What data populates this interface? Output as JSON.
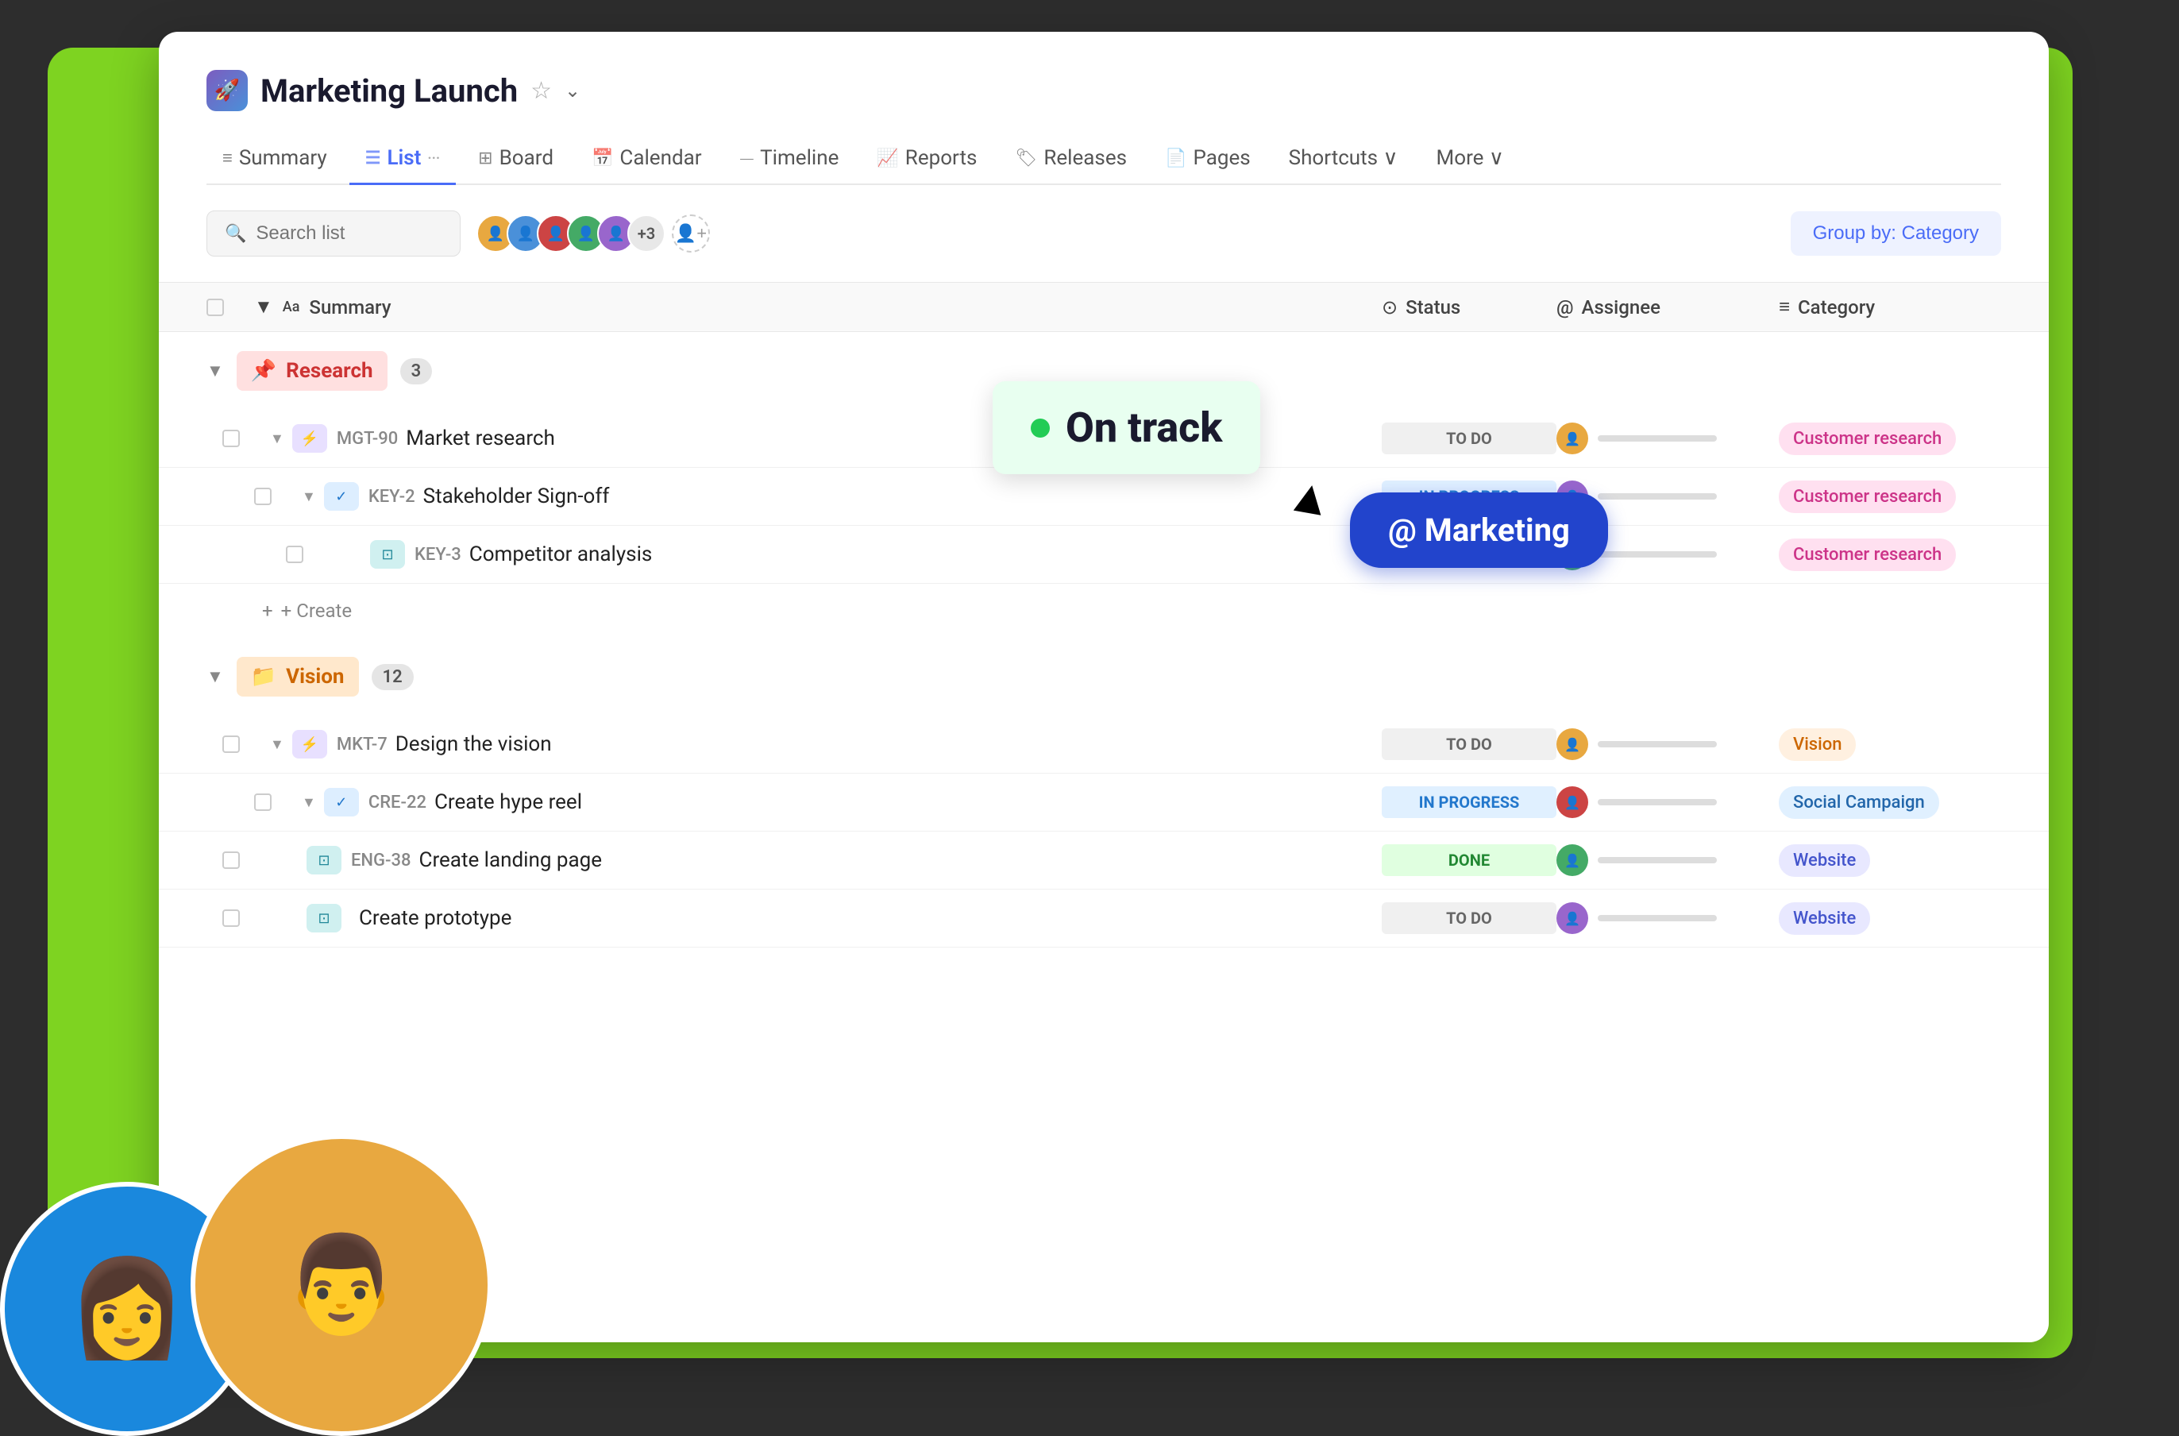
{
  "app": {
    "icon": "🚀",
    "title": "Marketing Launch",
    "star": "☆",
    "chevron": "⌄"
  },
  "nav": {
    "tabs": [
      {
        "id": "summary",
        "label": "Summary",
        "icon": "≡",
        "active": false
      },
      {
        "id": "list",
        "label": "List",
        "icon": "☰",
        "active": true
      },
      {
        "id": "board",
        "label": "Board",
        "icon": "⊞",
        "active": false
      },
      {
        "id": "calendar",
        "label": "Calendar",
        "icon": "📅",
        "active": false
      },
      {
        "id": "timeline",
        "label": "Timeline",
        "icon": "⏤",
        "active": false
      },
      {
        "id": "reports",
        "label": "Reports",
        "icon": "📈",
        "active": false
      },
      {
        "id": "releases",
        "label": "Releases",
        "icon": "🏷",
        "active": false
      },
      {
        "id": "pages",
        "label": "Pages",
        "icon": "📄",
        "active": false
      },
      {
        "id": "shortcuts",
        "label": "Shortcuts ∨",
        "icon": "⌨",
        "active": false
      },
      {
        "id": "more",
        "label": "More ∨",
        "icon": "",
        "active": false
      }
    ]
  },
  "toolbar": {
    "search_placeholder": "Search list",
    "group_by_label": "Group by: Category"
  },
  "table": {
    "headers": {
      "summary": "Summary",
      "status": "Status",
      "assignee": "Assignee",
      "category": "Category"
    }
  },
  "groups": [
    {
      "id": "research",
      "label": "Research",
      "icon": "📌",
      "color": "research",
      "count": "3",
      "rows": [
        {
          "id": "mgt90",
          "task_id": "MGT-90",
          "name": "Market research",
          "icon_type": "purple",
          "icon": "⚡",
          "status": "TO DO",
          "status_class": "status-todo",
          "category": "Customer research",
          "cat_class": "cat-customer",
          "indent": 1
        },
        {
          "id": "key2",
          "task_id": "KEY-2",
          "name": "Stakeholder Sign-off",
          "icon_type": "blue",
          "icon": "✓",
          "status": "IN PROGRESS",
          "status_class": "status-inprogress",
          "category": "Customer research",
          "cat_class": "cat-customer",
          "indent": 2
        },
        {
          "id": "key3",
          "task_id": "KEY-3",
          "name": "Competitor analysis",
          "icon_type": "teal",
          "icon": "⊡",
          "status": "",
          "status_class": "",
          "category": "Customer research",
          "cat_class": "cat-customer",
          "indent": 3
        }
      ]
    },
    {
      "id": "vision",
      "label": "Vision",
      "icon": "📁",
      "color": "vision",
      "count": "12",
      "rows": [
        {
          "id": "mkt7",
          "task_id": "MKT-7",
          "name": "Design the vision",
          "icon_type": "purple",
          "icon": "⚡",
          "status": "TO DO",
          "status_class": "status-todo",
          "category": "Vision",
          "cat_class": "cat-vision",
          "indent": 1
        },
        {
          "id": "cre22",
          "task_id": "CRE-22",
          "name": "Create hype reel",
          "icon_type": "blue",
          "icon": "✓",
          "status": "IN PROGRESS",
          "status_class": "status-inprogress",
          "category": "Social Campaign",
          "cat_class": "cat-social",
          "indent": 2
        },
        {
          "id": "eng38",
          "task_id": "ENG-38",
          "name": "Create landing page",
          "icon_type": "teal",
          "icon": "⊡",
          "status": "DONE",
          "status_class": "status-done",
          "category": "Website",
          "cat_class": "cat-website",
          "indent": 1
        },
        {
          "id": "proto",
          "task_id": "",
          "name": "Create prototype",
          "icon_type": "teal",
          "icon": "⊡",
          "status": "TO DO",
          "status_class": "status-todo",
          "category": "Website",
          "cat_class": "cat-website",
          "indent": 1
        }
      ]
    }
  ],
  "tooltip": {
    "text": "On track"
  },
  "marketing_tag": {
    "text": "@ Marketing"
  },
  "create_label": "+ Create"
}
